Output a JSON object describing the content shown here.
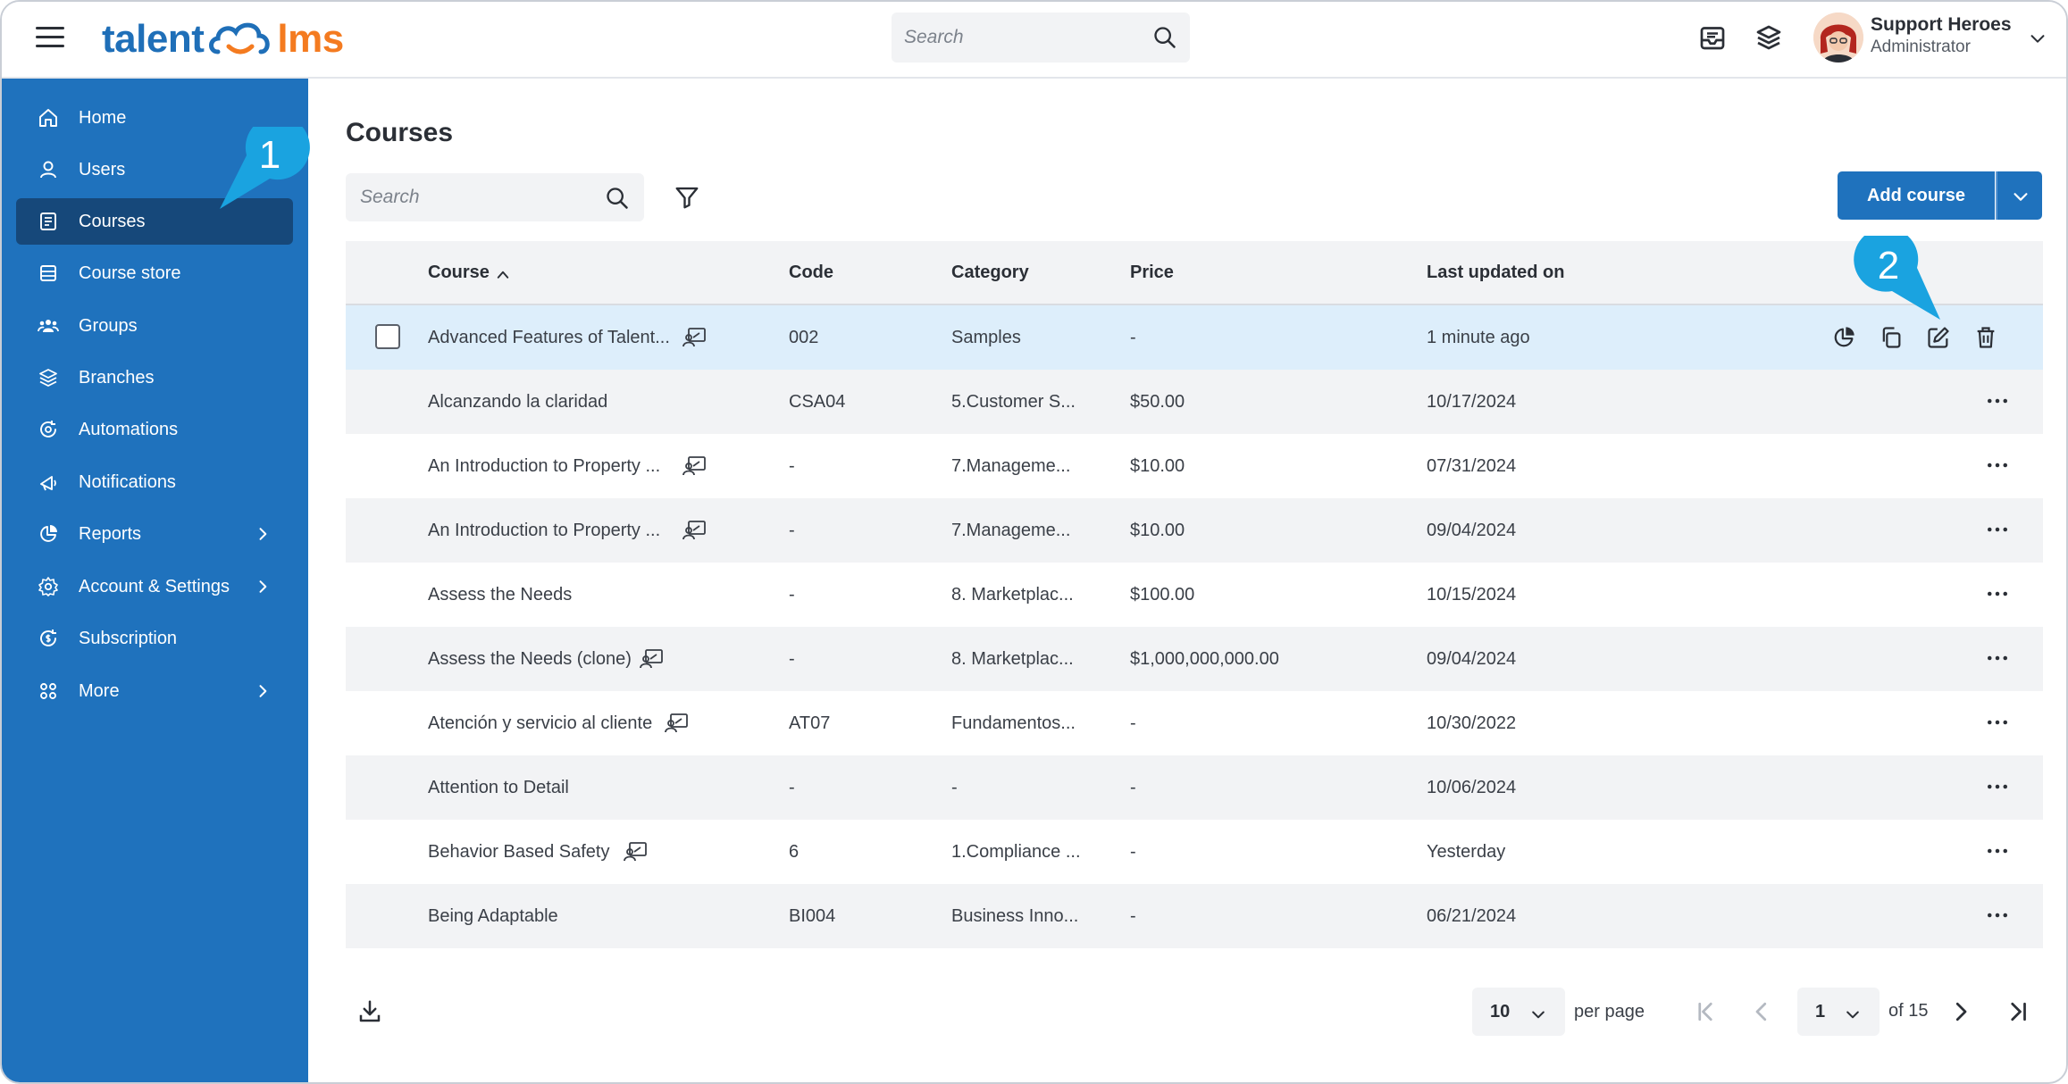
{
  "colors": {
    "primary": "#1f72bd",
    "active_nav": "#16487a",
    "accent": "#f47b20",
    "callout": "#1aa3e0"
  },
  "brand": {
    "part1": "talent",
    "part2": "lms"
  },
  "topbar": {
    "search_placeholder": "Search",
    "icons": [
      "inbox-icon",
      "layers-switch-icon"
    ],
    "user": {
      "name": "Support Heroes",
      "role": "Administrator"
    }
  },
  "sidebar": {
    "items": [
      {
        "label": "Home",
        "icon": "home-icon"
      },
      {
        "label": "Users",
        "icon": "user-icon"
      },
      {
        "label": "Courses",
        "icon": "courses-icon",
        "active": true
      },
      {
        "label": "Course store",
        "icon": "store-icon"
      },
      {
        "label": "Groups",
        "icon": "groups-icon"
      },
      {
        "label": "Branches",
        "icon": "branches-icon"
      },
      {
        "label": "Automations",
        "icon": "automations-icon"
      },
      {
        "label": "Notifications",
        "icon": "notifications-icon"
      },
      {
        "label": "Reports",
        "icon": "reports-icon",
        "submenu": true
      },
      {
        "label": "Account & Settings",
        "icon": "settings-icon",
        "submenu": true
      },
      {
        "label": "Subscription",
        "icon": "subscription-icon"
      },
      {
        "label": "More",
        "icon": "more-grid-icon",
        "submenu": true
      }
    ]
  },
  "main": {
    "title": "Courses",
    "search_placeholder": "Search",
    "add_course_label": "Add course"
  },
  "table": {
    "headers": {
      "course": "Course",
      "code": "Code",
      "category": "Category",
      "price": "Price",
      "updated": "Last updated on"
    },
    "rows": [
      {
        "course": "Advanced Features of Talent...",
        "code": "002",
        "category": "Samples",
        "price": "-",
        "updated": "1 minute ago",
        "ilt": true
      },
      {
        "course": "Alcanzando la claridad",
        "code": "CSA04",
        "category": "5.Customer S...",
        "price": "$50.00",
        "updated": "10/17/2024",
        "ilt": false
      },
      {
        "course": "An Introduction to Property ...",
        "code": "-",
        "category": "7.Manageme...",
        "price": "$10.00",
        "updated": "07/31/2024",
        "ilt": true
      },
      {
        "course": "An Introduction to Property ...",
        "code": "-",
        "category": "7.Manageme...",
        "price": "$10.00",
        "updated": "09/04/2024",
        "ilt": true
      },
      {
        "course": "Assess the Needs",
        "code": "-",
        "category": "8. Marketplac...",
        "price": "$100.00",
        "updated": "10/15/2024",
        "ilt": false
      },
      {
        "course": "Assess the Needs (clone)",
        "code": "-",
        "category": "8. Marketplac...",
        "price": "$1,000,000,000.00",
        "updated": "09/04/2024",
        "ilt": true
      },
      {
        "course": "Atención y servicio al cliente",
        "code": "AT07",
        "category": "Fundamentos...",
        "price": "-",
        "updated": "10/30/2022",
        "ilt": true
      },
      {
        "course": "Attention to Detail",
        "code": "-",
        "category": "-",
        "price": "-",
        "updated": "10/06/2024",
        "ilt": false
      },
      {
        "course": "Behavior Based Safety",
        "code": "6",
        "category": "1.Compliance ...",
        "price": "-",
        "updated": "Yesterday",
        "ilt": true
      },
      {
        "course": "Being Adaptable",
        "code": "BI004",
        "category": "Business Inno...",
        "price": "-",
        "updated": "06/21/2024",
        "ilt": false
      }
    ]
  },
  "pagination": {
    "per_page": "10",
    "per_page_label": "per page",
    "page": "1",
    "of_label": "of 15"
  },
  "callouts": [
    "1",
    "2"
  ]
}
